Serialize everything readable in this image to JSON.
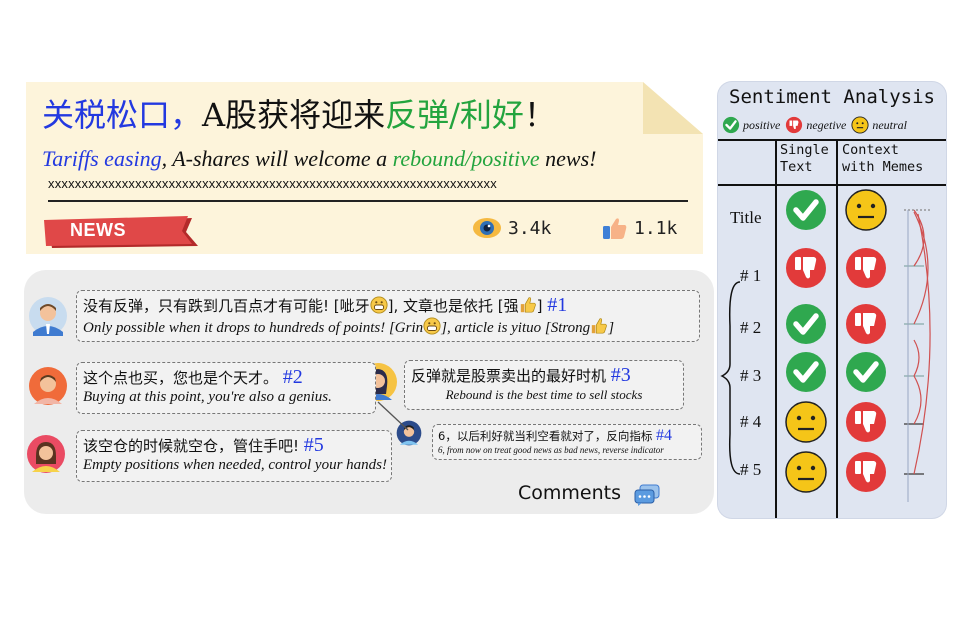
{
  "news": {
    "title_cn_1": "关税松口，",
    "title_cn_2": "A股获将迎来",
    "title_cn_3": "反弹/利好",
    "title_cn_4": "！",
    "title_en_1": "Tariffs easing",
    "title_en_2": ", A-shares will welcome a ",
    "title_en_3": "rebound/positive",
    "title_en_4": " news!",
    "placeholder": "xxxxxxxxxxxxxxxxxxxxxxxxxxxxxxxxxxxxxxxxxxxxxxxxxxxxxxxxxxxxxxxxxxx",
    "tag": "NEWS",
    "views": "3.4k",
    "likes": "1.1k"
  },
  "comments": {
    "c1": {
      "cn_a": "没有反弹，只有跌到几百点才有可能! [呲牙",
      "cn_b": "], 文章也是依托 [强",
      "cn_c": "]",
      "num": "#1",
      "en_a": "Only possible when it drops to hundreds of points! [Grin",
      "en_b": "], article is yituo [Strong",
      "en_c": "]"
    },
    "c2": {
      "cn": "这个点也买，您也是个天才。",
      "num": "#2",
      "en": "Buying at this point, you're also a genius."
    },
    "c3": {
      "cn": "反弹就是股票卖出的最好时机",
      "num": "#3",
      "en": "Rebound is the best time to sell stocks"
    },
    "c4": {
      "cn": "6，以后利好就当利空看就对了，反向指标",
      "num": "#4",
      "en": "6, from now on treat good news as bad news, reverse indicator"
    },
    "c5": {
      "cn": "该空仓的时候就空仓，管住手吧!",
      "num": "#5",
      "en": "Empty positions when needed, control your hands!"
    },
    "label": "Comments"
  },
  "sentiment": {
    "title": "Sentiment Analysis",
    "legend": {
      "positive": "positive",
      "negative": "negetive",
      "neutral": "neutral"
    },
    "col1": [
      "Single",
      "Text"
    ],
    "col2": [
      "Context",
      "with Memes"
    ],
    "rows": [
      {
        "label": "Title",
        "single": "positive",
        "context": "neutral"
      },
      {
        "label": "# 1",
        "single": "negative",
        "context": "negative"
      },
      {
        "label": "# 2",
        "single": "positive",
        "context": "negative"
      },
      {
        "label": "# 3",
        "single": "positive",
        "context": "positive"
      },
      {
        "label": "# 4",
        "single": "neutral",
        "context": "negative"
      },
      {
        "label": "# 5",
        "single": "neutral",
        "context": "negative"
      }
    ],
    "colors": {
      "positive": "#2fa84f",
      "negative": "#e23a3a",
      "neutral": "#f5c518"
    }
  }
}
